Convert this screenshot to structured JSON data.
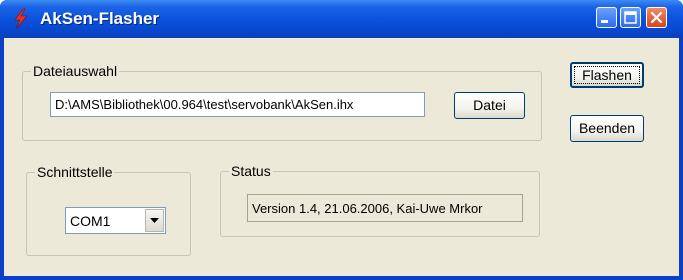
{
  "window": {
    "title": "AkSen-Flasher",
    "colors": {
      "titlebar": "#0a52dd",
      "client": "#ece9d8",
      "close": "#d2461c"
    },
    "controls": {
      "minimize_icon": "minimize-icon",
      "maximize_icon": "maximize-icon",
      "close_icon": "close-icon"
    }
  },
  "dateiauswahl": {
    "label": "Dateiauswahl",
    "path_value": "D:\\AMS\\Bibliothek\\00.964\\test\\servobank\\AkSen.ihx",
    "browse_label": "Datei"
  },
  "actions": {
    "flash_label": "Flashen",
    "exit_label": "Beenden"
  },
  "schnittstelle": {
    "label": "Schnittstelle",
    "selected": "COM1"
  },
  "status": {
    "label": "Status",
    "text": "Version 1.4, 21.06.2006, Kai-Uwe Mrkor"
  }
}
